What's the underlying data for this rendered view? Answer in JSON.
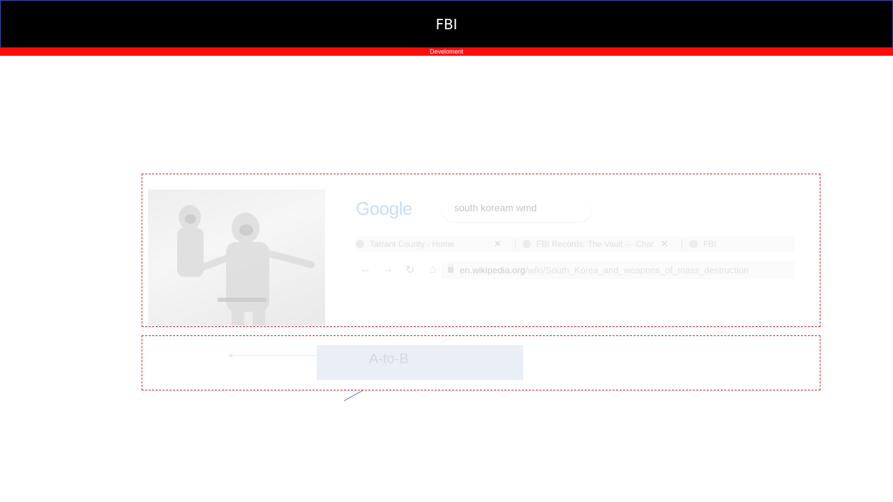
{
  "header": {
    "title": "FBI"
  },
  "subbar": {
    "label": "Develoment"
  },
  "screenshot": {
    "search": {
      "logo": "Google",
      "query": "south koream wmd"
    },
    "tabs": [
      {
        "label": "Tarrant County - Home",
        "icon": "page-icon",
        "close": "✕"
      },
      {
        "label": "FBI Records: The Vault — Charle",
        "icon": "clock-icon",
        "close": "✕"
      },
      {
        "label": "FBI",
        "icon": "globe-icon"
      }
    ],
    "nav": {
      "back": "←",
      "forward": "→",
      "reload": "↻",
      "home": "⌂"
    },
    "address": {
      "host": "en.wikipedia.org",
      "path": "/wiki/South_Korea_and_weapons_of_mass_destruction"
    }
  },
  "diagram": {
    "node_label": "A-to-B"
  },
  "colors": {
    "header_bg": "#000000",
    "subbar_bg": "#ff0d0d",
    "frame": "#d42020",
    "node_fill": "#eaeff6",
    "connector": "#4a6fb5"
  }
}
